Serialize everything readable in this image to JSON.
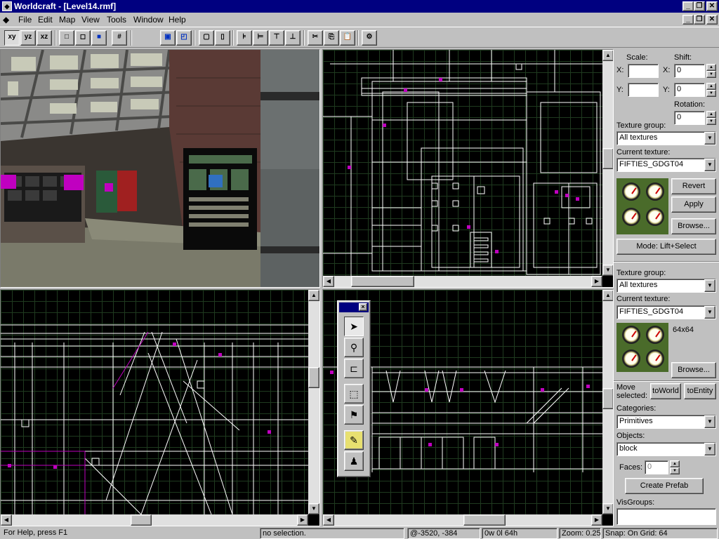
{
  "window": {
    "title": "Worldcraft - [Level14.rmf]"
  },
  "caption_buttons": {
    "minimize": "_",
    "restore": "❐",
    "close": "✕"
  },
  "menu": [
    {
      "label": "File"
    },
    {
      "label": "Edit"
    },
    {
      "label": "Map"
    },
    {
      "label": "View"
    },
    {
      "label": "Tools"
    },
    {
      "label": "Window"
    },
    {
      "label": "Help"
    }
  ],
  "toolbar": {
    "views": [
      "xy",
      "yz",
      "xz"
    ],
    "icons": [
      "wireframe-icon",
      "flat-icon",
      "textured-icon",
      "grid-icon",
      "group-icon",
      "ungroup-icon",
      "hide-icon",
      "show-icon",
      "align-left-icon",
      "align-right-icon",
      "align-top-icon",
      "align-bottom-icon",
      "cut-icon",
      "copy-icon",
      "paste-icon",
      "properties-icon"
    ]
  },
  "viewports": {
    "camera": {
      "name": "3d-camera-view"
    },
    "top": {
      "name": "top-view"
    },
    "front": {
      "name": "front-view"
    },
    "side": {
      "name": "side-view"
    }
  },
  "toolwindow": {
    "tools": [
      "selection-tool-icon",
      "magnify-tool-icon",
      "camera-tool-icon",
      "entity-tool-icon",
      "block-tool-icon",
      "texture-tool-icon",
      "decal-tool-icon",
      "clip-tool-icon"
    ]
  },
  "texture_app": {
    "scale_label": "Scale:",
    "shift_label": "Shift:",
    "x_label": "X:",
    "y_label": "Y:",
    "scale_x": "",
    "scale_y": "",
    "shift_x": "0",
    "shift_y": "0",
    "rotation_label": "Rotation:",
    "rotation": "0",
    "group_label": "Texture group:",
    "group_value": "All textures",
    "current_label": "Current texture:",
    "current_value": "FIFTIES_GDGT04",
    "revert": "Revert",
    "apply": "Apply",
    "browse": "Browse...",
    "mode": "Mode: Lift+Select"
  },
  "texture_bar": {
    "group_label": "Texture group:",
    "group_value": "All textures",
    "current_label": "Current texture:",
    "current_value": "FIFTIES_GDGT04",
    "size": "64x64",
    "browse": "Browse..."
  },
  "object_bar": {
    "move_label": "Move selected:",
    "to_world": "toWorld",
    "to_entity": "toEntity",
    "categories_label": "Categories:",
    "categories_value": "Primitives",
    "objects_label": "Objects:",
    "objects_value": "block",
    "faces_label": "Faces:",
    "faces_value": "0",
    "create_prefab": "Create Prefab",
    "visgroups_label": "VisGroups:"
  },
  "status": {
    "help": "For Help, press F1",
    "selection": "no selection.",
    "coords": "@-3520, -384",
    "size": "0w 0l 64h",
    "zoom": "Zoom: 0.25",
    "snap": "Snap: On Grid: 64"
  }
}
